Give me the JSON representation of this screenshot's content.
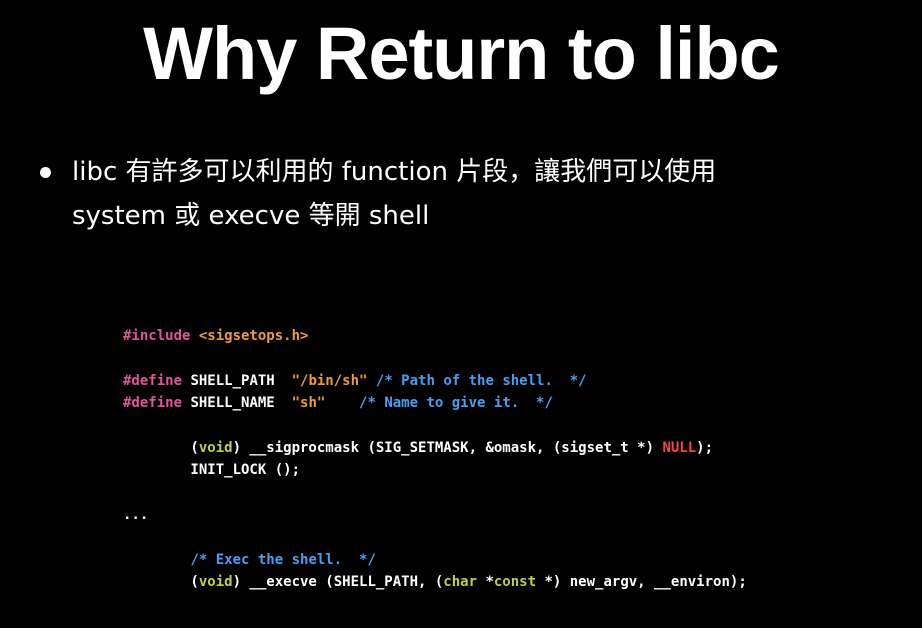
{
  "slide": {
    "title": "Why Return to libc",
    "bullets": [
      {
        "lines": [
          "libc 有許多可以利用的 function 片段，讓我們可以使用",
          "system 或 execve 等開 shell"
        ]
      }
    ]
  },
  "code": {
    "lines": [
      [
        {
          "text": "#include ",
          "kind": "pre"
        },
        {
          "text": "<sigsetops.h>",
          "kind": "str"
        }
      ],
      [],
      [
        {
          "text": "#define ",
          "kind": "pre"
        },
        {
          "text": "SHELL_PATH  ",
          "kind": "plain"
        },
        {
          "text": "\"/bin/sh\"",
          "kind": "str"
        },
        {
          "text": " ",
          "kind": "plain"
        },
        {
          "text": "/* Path of the shell.  */",
          "kind": "cmt"
        }
      ],
      [
        {
          "text": "#define ",
          "kind": "pre"
        },
        {
          "text": "SHELL_NAME  ",
          "kind": "plain"
        },
        {
          "text": "\"sh\"",
          "kind": "str"
        },
        {
          "text": "    ",
          "kind": "plain"
        },
        {
          "text": "/* Name to give it.  */",
          "kind": "cmt"
        }
      ],
      [],
      [
        {
          "text": "        (",
          "kind": "plain"
        },
        {
          "text": "void",
          "kind": "kw"
        },
        {
          "text": ") __sigprocmask (SIG_SETMASK, &omask, (sigset_t *) ",
          "kind": "plain"
        },
        {
          "text": "NULL",
          "kind": "null"
        },
        {
          "text": ");",
          "kind": "plain"
        }
      ],
      [
        {
          "text": "        INIT_LOCK ();",
          "kind": "plain"
        }
      ],
      [],
      [
        {
          "text": "...",
          "kind": "plain"
        }
      ],
      [],
      [
        {
          "text": "        ",
          "kind": "plain"
        },
        {
          "text": "/* Exec the shell.  */",
          "kind": "cmt"
        }
      ],
      [
        {
          "text": "        (",
          "kind": "plain"
        },
        {
          "text": "void",
          "kind": "kw"
        },
        {
          "text": ") __execve (SHELL_PATH, (",
          "kind": "plain"
        },
        {
          "text": "char",
          "kind": "kw"
        },
        {
          "text": " *",
          "kind": "plain"
        },
        {
          "text": "const",
          "kind": "kw"
        },
        {
          "text": " *) new_argv, __environ);",
          "kind": "plain"
        }
      ]
    ]
  },
  "colors": {
    "background": "#000000",
    "text": "#ffffff",
    "preprocessor": "#e0569a",
    "string": "#f09a3a",
    "comment": "#4a9ef2",
    "keyword": "#c2cf3e",
    "null": "#f2494a"
  }
}
